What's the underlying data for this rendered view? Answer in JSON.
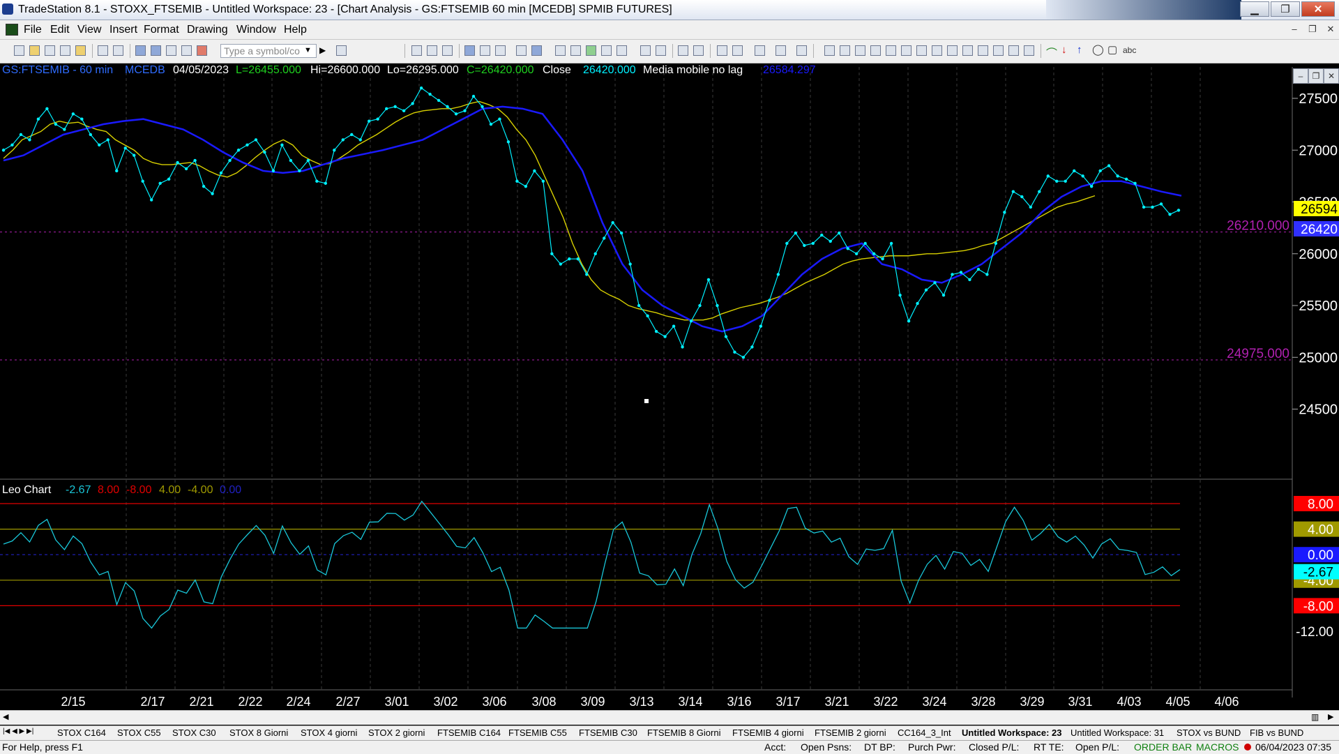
{
  "window": {
    "title": "TradeStation 8.1 - STOXX_FTSEMIB - Untitled Workspace:  23 - [Chart Analysis - GS:FTSEMIB  60 min  [MCEDB] SPMIB FUTURES]",
    "minimize": "▁",
    "maximize": "❐",
    "close": "✕"
  },
  "menu": [
    "File",
    "Edit",
    "View",
    "Insert",
    "Format",
    "Drawing",
    "Window",
    "Help"
  ],
  "mdi_buttons": [
    "–",
    "❐",
    "✕"
  ],
  "toolbar": {
    "symbol_placeholder": "Type a symbol/co",
    "text_tool": "abc"
  },
  "info": {
    "symbol": "GS:FTSEMIB - 60 min",
    "exchange": "MCEDB",
    "date": "04/05/2023",
    "low": "L=26455.000",
    "hi": "Hi=26600.000",
    "lo": "Lo=26295.000",
    "close_c": "C=26420.000",
    "close_word": "Close",
    "close_val": "26420.000",
    "indicator": "Media mobile no lag",
    "indicator_val": "26584.297"
  },
  "colors": {
    "price": "#00f0ff",
    "ma_blue": "#1a1aff",
    "ma_yellow": "#d8d000",
    "level_purple": "#b020b0",
    "osc": "#19c6d8",
    "red": "#e00000",
    "olive": "#a09a00",
    "navy_dash": "#2020c0",
    "grid": "#3a3a3a"
  },
  "price_axis": {
    "labels": [
      "27500",
      "27000",
      "26500",
      "26000",
      "25500",
      "25000",
      "24500"
    ]
  },
  "price_tags": {
    "yellow": "26594",
    "blue": "26420"
  },
  "levels": [
    {
      "value": 26210,
      "label": "26210.000"
    },
    {
      "value": 24975,
      "label": "24975.000"
    }
  ],
  "oscillator": {
    "name": "Leo Chart",
    "value": "-2.67",
    "params": [
      "8.00",
      "-8.00",
      "4.00",
      "-4.00",
      "0.00"
    ],
    "axis_labels": [
      "8.00",
      "4.00",
      "0.00",
      "-4.00",
      "-8.00",
      "-12.00"
    ],
    "tag_value": "-2.67"
  },
  "date_axis": [
    "2/15",
    "2/17",
    "2/21",
    "2/22",
    "2/24",
    "2/27",
    "3/01",
    "3/02",
    "3/06",
    "3/08",
    "3/09",
    "3/13",
    "3/14",
    "3/16",
    "3/17",
    "3/21",
    "3/22",
    "3/24",
    "3/28",
    "3/29",
    "3/31",
    "4/03",
    "4/05",
    "4/06"
  ],
  "chart_data": {
    "type": "line",
    "title": "GS:FTSEMIB - 60 min",
    "ylim": [
      24300,
      27700
    ],
    "series": [
      {
        "values": [
          27000,
          27050,
          27150,
          27100,
          27300,
          27400,
          27250,
          27200,
          27350,
          27300,
          27150,
          27050,
          27100,
          26800,
          27020,
          26950,
          26700,
          26520,
          26680,
          26720,
          26880,
          26820,
          26900,
          26650,
          26580,
          26780,
          26900,
          27000,
          27050,
          27100,
          26980,
          26800,
          27050,
          26900,
          26800,
          26900,
          26700,
          26680,
          27000,
          27100,
          27150,
          27100,
          27280,
          27300,
          27400,
          27420,
          27380,
          27450,
          27600,
          27540,
          27480,
          27420,
          27350,
          27380,
          27520,
          27420,
          27250,
          27300,
          27080,
          26700,
          26650,
          26800,
          26700,
          26000,
          25900,
          25950,
          25950,
          25800,
          26000,
          26150,
          26300,
          26200,
          25900,
          25500,
          25400,
          25250,
          25200,
          25300,
          25100,
          25350,
          25500,
          25750,
          25500,
          25200,
          25050,
          25000,
          25100,
          25300,
          25550,
          25800,
          26100,
          26200,
          26080,
          26100,
          26180,
          26120,
          26200,
          26050,
          26000,
          26100,
          26000,
          25950,
          26100,
          25600,
          25350,
          25520,
          25650,
          25720,
          25600,
          25800,
          25820,
          25750,
          25850,
          25800,
          26100,
          26400,
          26600,
          26550,
          26450,
          26600,
          26750,
          26700,
          26700,
          26800,
          26750,
          26650,
          26800,
          26850,
          26750,
          26720,
          26680,
          26450,
          26450,
          26480,
          26380,
          26420
        ]
      },
      {
        "values": [
          26920,
          27000,
          27100,
          27140,
          27180,
          27250,
          27280,
          27260,
          27270,
          27230,
          27200,
          27180,
          27100,
          27050,
          27000,
          26920,
          26880,
          26860,
          26860,
          26870,
          26880,
          26850,
          26800,
          26760,
          26740,
          26780,
          26850,
          26930,
          27000,
          27060,
          27100,
          27050,
          26950,
          26900,
          26860,
          26870,
          26920,
          26980,
          27050,
          27100,
          27150,
          27210,
          27270,
          27320,
          27360,
          27380,
          27390,
          27400,
          27400,
          27420,
          27450,
          27470,
          27440,
          27400,
          27320,
          27200,
          27100,
          26950,
          26750,
          26550,
          26350,
          26100,
          25900,
          25750,
          25650,
          25600,
          25560,
          25500,
          25470,
          25450,
          25430,
          25400,
          25380,
          25360,
          25360,
          25360,
          25380,
          25420,
          25450,
          25480,
          25500,
          25520,
          25550,
          25580,
          25620,
          25670,
          25720,
          25760,
          25800,
          25850,
          25900,
          25930,
          25950,
          25960,
          25970,
          25980,
          25980,
          25980,
          25990,
          26000,
          26000,
          26010,
          26020,
          26030,
          26050,
          26080,
          26100,
          26150,
          26200,
          26250,
          26300,
          26350,
          26400,
          26450,
          26480,
          26500,
          26530,
          26560
        ]
      },
      {
        "values": [
          26900,
          26950,
          27050,
          27150,
          27200,
          27250,
          27280,
          27300,
          27250,
          27200,
          27100,
          26980,
          26880,
          26800,
          26780,
          26800,
          26860,
          26920,
          26960,
          27000,
          27050,
          27100,
          27200,
          27300,
          27400,
          27420,
          27400,
          27350,
          27100,
          26800,
          26300,
          25900,
          25650,
          25500,
          25400,
          25300,
          25250,
          25300,
          25400,
          25600,
          25800,
          25950,
          26050,
          26100,
          25900,
          25850,
          25750,
          25720,
          25800,
          25900,
          26050,
          26200,
          26400,
          26550,
          26650,
          26700,
          26700,
          26650,
          26600,
          26560
        ]
      }
    ]
  }
}
